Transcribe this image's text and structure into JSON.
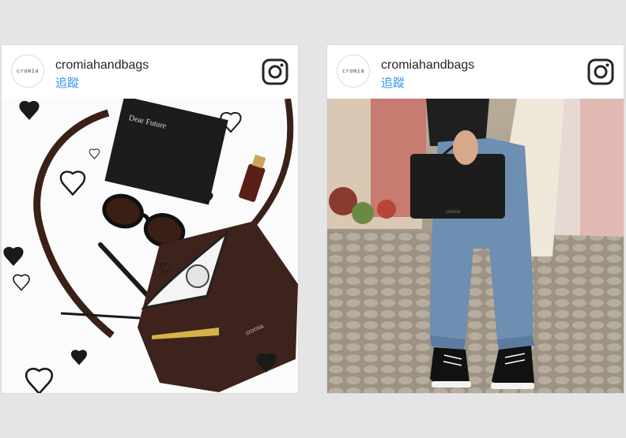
{
  "posts": [
    {
      "username": "cromiahandbags",
      "follow_label": "追蹤",
      "avatar_text": "cromia",
      "photo": {
        "desc_icon": "flatlay-photo",
        "notebook_text": "Dear Future",
        "bag_brand": "cromia"
      }
    },
    {
      "username": "cromiahandbags",
      "follow_label": "追蹤",
      "avatar_text": "cromia",
      "photo": {
        "desc_icon": "street-photo",
        "bag_brand": "cromia"
      }
    }
  ],
  "colors": {
    "follow": "#3897f0",
    "border": "#dbdbdb",
    "text": "#262626",
    "background": "#e5e5e5"
  }
}
